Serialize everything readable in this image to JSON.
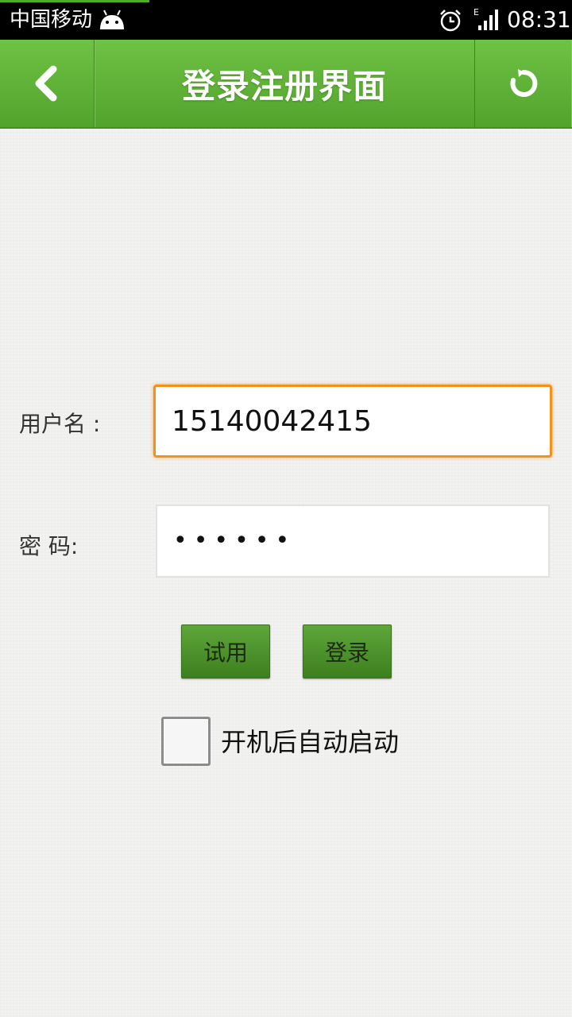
{
  "status_bar": {
    "carrier": "中国移动",
    "network_type": "E",
    "time": "08:31",
    "icons": [
      "android-icon",
      "alarm-icon",
      "signal-icon"
    ]
  },
  "title_bar": {
    "title": "登录注册界面",
    "back_icon": "chevron-left-icon",
    "refresh_icon": "refresh-icon"
  },
  "form": {
    "username_label": "用户名 :",
    "username_value": "15140042415",
    "password_label": "密 码:",
    "password_value": "••••••",
    "trial_button": "试用",
    "login_button": "登录",
    "autostart_label": "开机后自动启动",
    "autostart_checked": false
  },
  "colors": {
    "title_bar": "#5fb239",
    "focus_border": "#f5901a",
    "button_green": "#4e9430"
  }
}
